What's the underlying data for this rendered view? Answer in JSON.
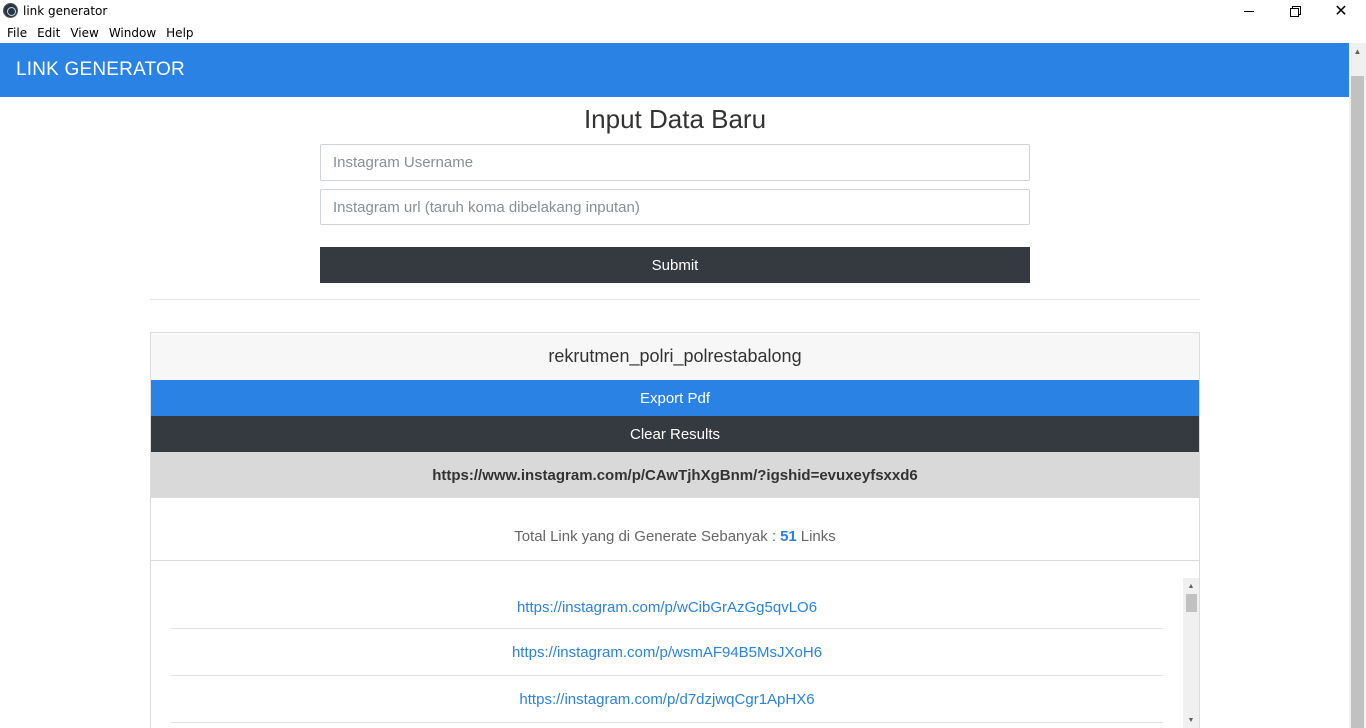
{
  "window": {
    "title": "link generator",
    "icons": {
      "app": "electron-icon",
      "minimize": "minimize-icon",
      "maximize": "restore-icon",
      "close": "close-icon"
    }
  },
  "menubar": {
    "items": [
      "File",
      "Edit",
      "View",
      "Window",
      "Help"
    ]
  },
  "header": {
    "title": "LINK GENERATOR",
    "color": "#2a82e4"
  },
  "form": {
    "title": "Input Data Baru",
    "username_placeholder": "Instagram Username",
    "url_placeholder": "Instagram url (taruh koma dibelakang inputan)",
    "submit_label": "Submit"
  },
  "results": {
    "username": "rekrutmen_polri_polrestabalong",
    "export_label": "Export Pdf",
    "clear_label": "Clear Results",
    "source_url": "https://www.instagram.com/p/CAwTjhXgBnm/?igshid=evuxeyfsxxd6",
    "total_prefix": "Total Link yang di Generate Sebanyak :",
    "total_count": "51",
    "total_suffix": "Links",
    "links": [
      "https://instagram.com/p/wCibGrAzGg5qvLO6",
      "https://instagram.com/p/wsmAF94B5MsJXoH6",
      "https://instagram.com/p/d7dzjwqCgr1ApHX6"
    ]
  },
  "colors": {
    "primary": "#2a82e4",
    "dark": "#343a40",
    "muted": "#d9d9d9"
  }
}
